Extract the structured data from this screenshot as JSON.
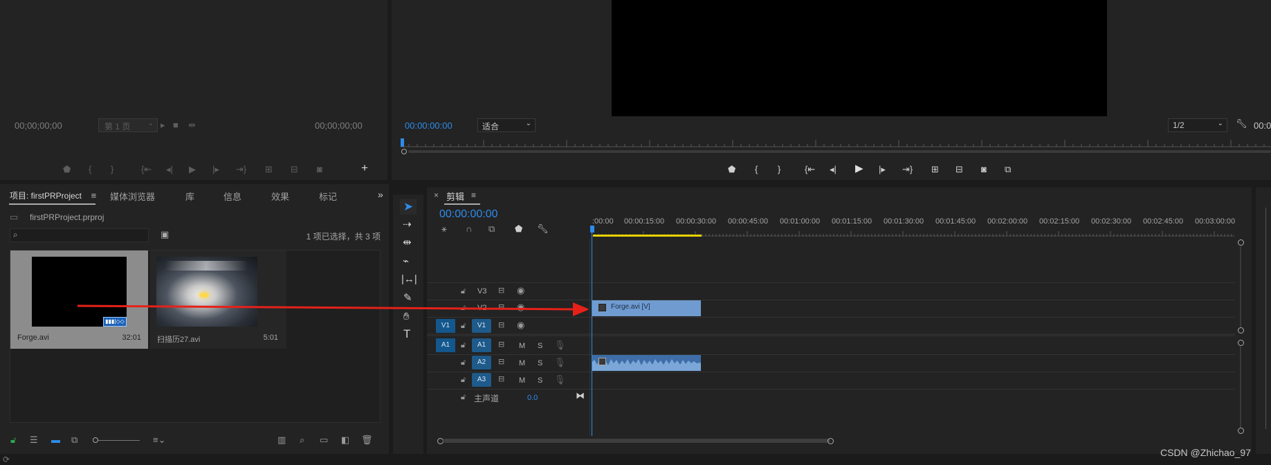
{
  "source_monitor": {
    "timecode_left": "00;00;00;00",
    "page_select": "第 1 页",
    "timecode_right": "00;00;00;00"
  },
  "program_monitor": {
    "timecode": "00:00:00:00",
    "fit_select": "适合",
    "resolution_select": "1/2",
    "timecode_right": "00:0"
  },
  "project_panel": {
    "tabs": [
      "项目: firstPRProject",
      "媒体浏览器",
      "库",
      "信息",
      "效果",
      "标记"
    ],
    "project_file": "firstPRProject.prproj",
    "search_placeholder": "",
    "selection_status": "1 项已选择，共 3 项",
    "clips": [
      {
        "name": "Forge.avi",
        "duration": "32:01"
      },
      {
        "name": "扫描历27.avi",
        "duration": "5:01"
      }
    ]
  },
  "timeline": {
    "close_label": "×",
    "title": "剪辑",
    "timecode": "00:00:00:00",
    "ruler_labels": [
      ":00:00",
      "00:00:15:00",
      "00:00:30:00",
      "00:00:45:00",
      "00:01:00:00",
      "00:01:15:00",
      "00:01:30:00",
      "00:01:45:00",
      "00:02:00:00",
      "00:02:15:00",
      "00:02:30:00",
      "00:02:45:00",
      "00:03:00:00"
    ],
    "tracks": {
      "v3": "V3",
      "v2": "V2",
      "v1_src": "V1",
      "v1": "V1",
      "a1_src": "A1",
      "a1": "A1",
      "a2": "A2",
      "a3": "A3",
      "mute": "M",
      "solo": "S",
      "master_label": "主声道",
      "master_value": "0.0"
    },
    "video_clip_label": "Forge.avi [V]"
  },
  "watermark": "CSDN @Zhichao_97",
  "colors": {
    "accent_blue": "#2d8ceb",
    "video_clip": "#6f9bd0",
    "audio_clip": "#3e6da8",
    "arrow": "#e6211a",
    "playhead": "#2d8ceb",
    "work_area": "#e8d200"
  }
}
